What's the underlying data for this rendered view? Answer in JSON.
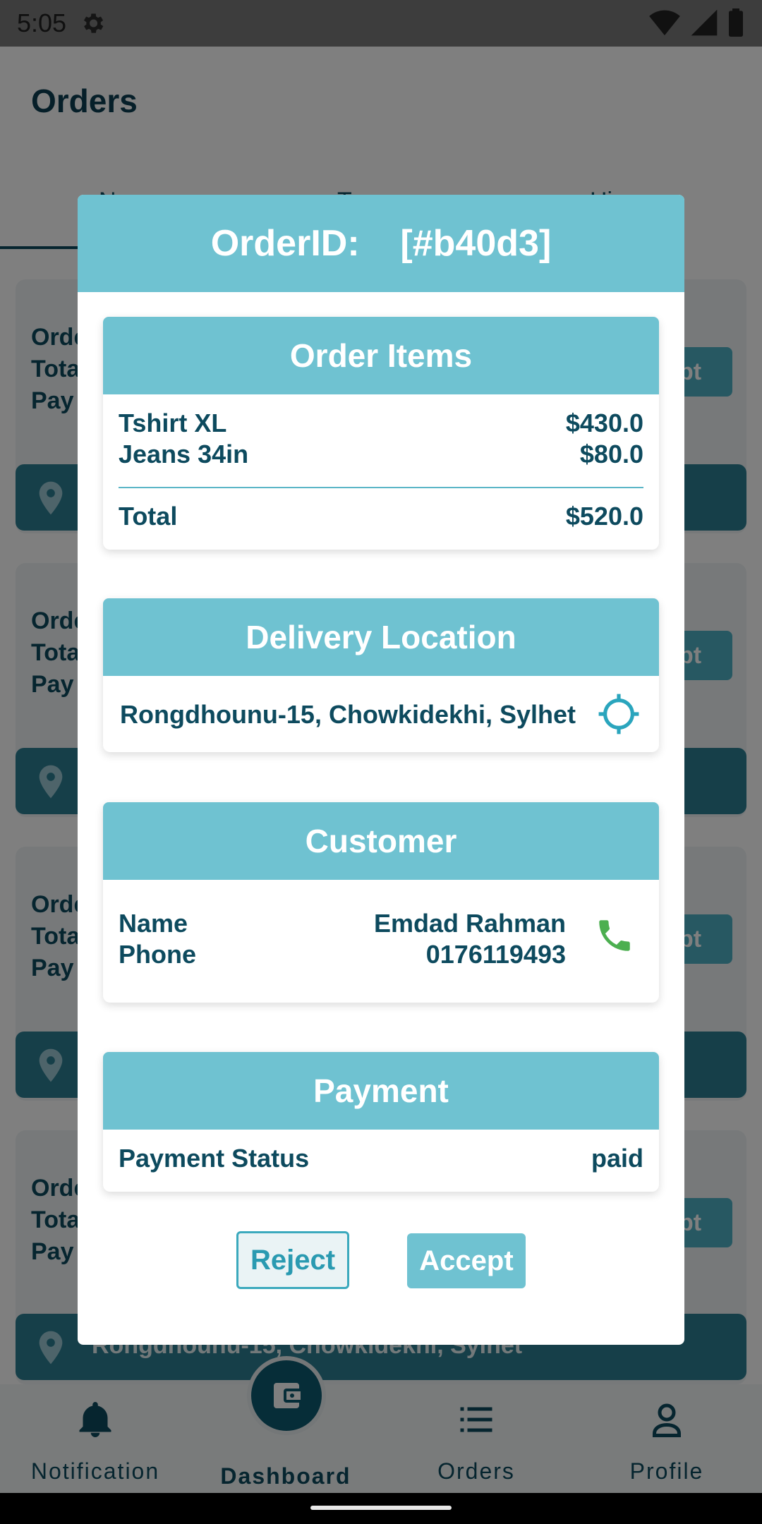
{
  "status_bar": {
    "time": "5:05"
  },
  "app": {
    "title": "Orders",
    "tabs": [
      "N",
      "T",
      "Hi"
    ],
    "bg_cards": [
      {
        "lines": [
          "Orde",
          "Tota",
          "Pay"
        ],
        "accept": "pt",
        "location": ""
      },
      {
        "lines": [
          "Orde",
          "Tota",
          "Pay"
        ],
        "accept": "pt",
        "location": ""
      },
      {
        "lines": [
          "Orde",
          "Tota",
          "Pay"
        ],
        "accept": "pt",
        "location": ""
      },
      {
        "lines": [
          "Orde",
          "Tota",
          "Pay"
        ],
        "accept": "pt",
        "location": "Rongdhounu-15, Chowkidekhi, Sylhet"
      }
    ]
  },
  "bottom_nav": {
    "notification": "Notification",
    "dashboard": "Dashboard",
    "orders": "Orders",
    "profile": "Profile"
  },
  "dialog": {
    "title": "OrderID:    [#b40d3]",
    "order_items": {
      "heading": "Order Items",
      "items": [
        {
          "name": "Tshirt XL",
          "price": "$430.0"
        },
        {
          "name": "Jeans 34in",
          "price": "$80.0"
        }
      ],
      "total_label": "Total",
      "total_value": "$520.0"
    },
    "delivery": {
      "heading": "Delivery Location",
      "address": "Rongdhounu-15, Chowkidekhi, Sylhet"
    },
    "customer": {
      "heading": "Customer",
      "name_label": "Name",
      "phone_label": "Phone",
      "name_value": "Emdad Rahman",
      "phone_value": "0176119493"
    },
    "payment": {
      "heading": "Payment",
      "status_label": "Payment Status",
      "status_value": "paid"
    },
    "reject_label": "Reject",
    "accept_label": "Accept"
  },
  "colors": {
    "accent": "#6fc2d1",
    "text": "#0d4a5e",
    "phone": "#4caf50"
  }
}
